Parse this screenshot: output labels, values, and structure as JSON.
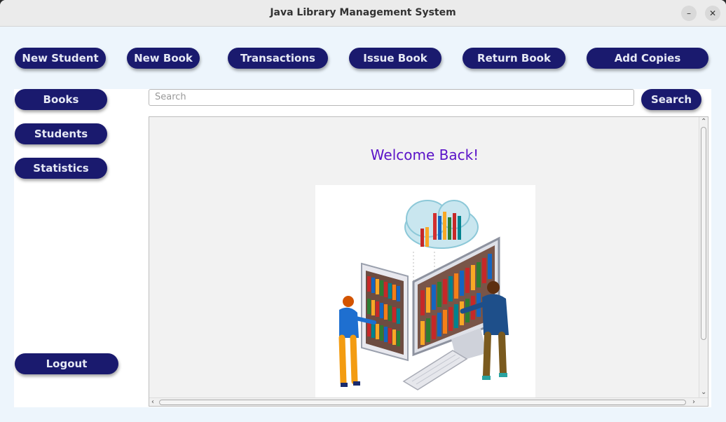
{
  "window": {
    "title": "Java Library Management System",
    "minimize": "–",
    "close": "✕"
  },
  "topbar": {
    "new_student": "New Student",
    "new_book": "New Book",
    "transactions": "Transactions",
    "issue_book": "Issue Book",
    "return_book": "Return Book",
    "add_copies": "Add Copies"
  },
  "sidebar": {
    "books": "Books",
    "students": "Students",
    "statistics": "Statistics",
    "logout": "Logout"
  },
  "search": {
    "placeholder": "Search",
    "button": "Search"
  },
  "main": {
    "welcome": "Welcome Back!"
  },
  "colors": {
    "button_bg": "#1a1a6e",
    "button_text": "#e6e9f5",
    "welcome_text": "#5a12c8",
    "window_bg": "#edf5fc"
  }
}
